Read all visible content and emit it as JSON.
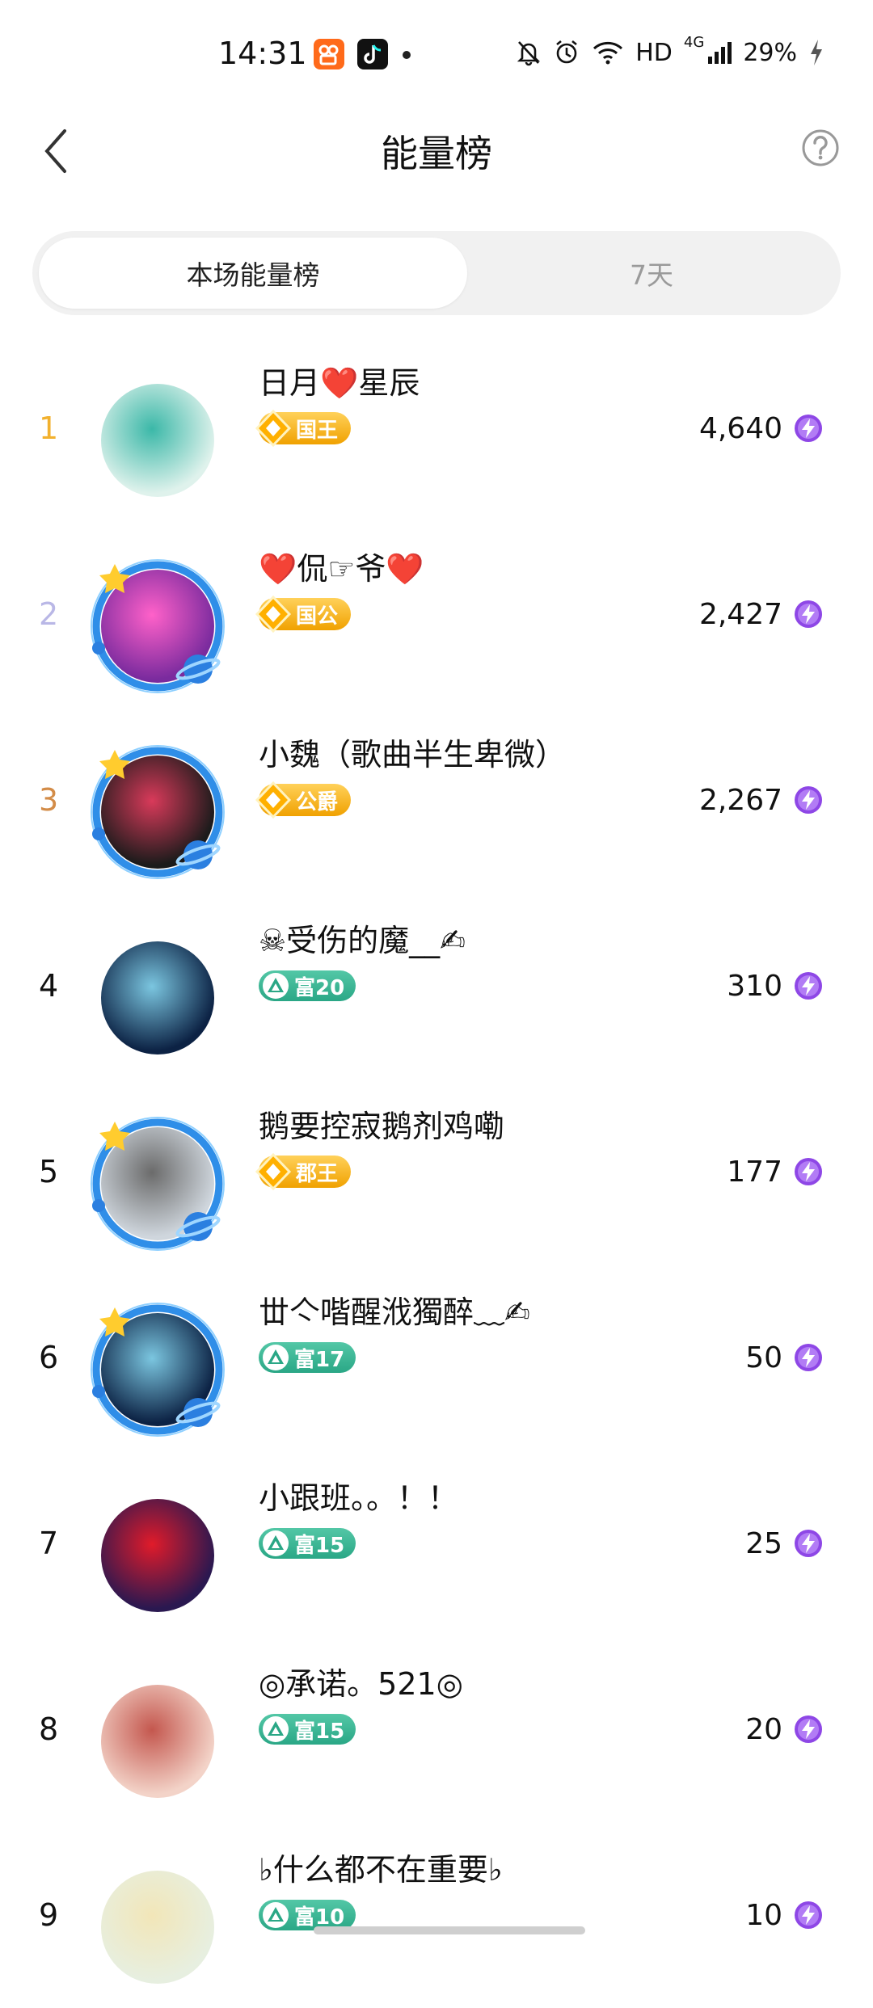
{
  "status": {
    "time": "14:31",
    "network": "HD",
    "signal": "4G",
    "battery": "29%"
  },
  "header": {
    "title": "能量榜"
  },
  "tabs": [
    {
      "label": "本场能量榜",
      "active": true
    },
    {
      "label": "7天",
      "active": false
    }
  ],
  "colors": {
    "rank1": "#f2b12e",
    "rank2": "#b9b7e6",
    "rank3": "#d38c48",
    "bolt": "#8e47e6",
    "gold_badge": "#f0a100",
    "green_badge": "#2aa786"
  },
  "rows": [
    {
      "rank": "1",
      "name": "日月❤️星辰",
      "badge": "国王",
      "badge_type": "gold",
      "score": "4,640",
      "frame": false
    },
    {
      "rank": "2",
      "name": "❤️侃☞爷❤️",
      "badge": "国公",
      "badge_type": "gold",
      "score": "2,427",
      "frame": true
    },
    {
      "rank": "3",
      "name": "小魏（歌曲半生卑微）",
      "badge": "公爵",
      "badge_type": "gold",
      "score": "2,267",
      "frame": true
    },
    {
      "rank": "4",
      "name": "☠受伤的魔__✍",
      "badge": "富20",
      "badge_type": "green",
      "score": "310",
      "frame": false
    },
    {
      "rank": "5",
      "name": "鹅要控寂鹅剂鸡嘞",
      "badge": "郡王",
      "badge_type": "gold",
      "score": "177",
      "frame": true
    },
    {
      "rank": "6",
      "name": "丗亽喈醒浌獨醉﹏✍",
      "badge": "富17",
      "badge_type": "green",
      "score": "50",
      "frame": true
    },
    {
      "rank": "7",
      "name": "小跟班。。！！",
      "badge": "富15",
      "badge_type": "green",
      "score": "25",
      "frame": false
    },
    {
      "rank": "8",
      "name": "◎承诺。521◎",
      "badge": "富15",
      "badge_type": "green",
      "score": "20",
      "frame": false
    },
    {
      "rank": "9",
      "name": "♭什么都不在重要♭",
      "badge": "富10",
      "badge_type": "green",
      "score": "10",
      "frame": false
    }
  ]
}
